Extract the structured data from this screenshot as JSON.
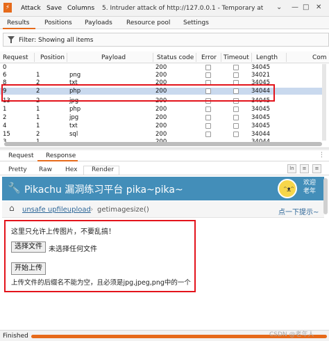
{
  "app": {
    "menu": {
      "attack": "Attack",
      "save": "Save",
      "columns": "Columns"
    },
    "window_title": "5. Intruder attack of http://127.0.0.1 - Temporary attack - ."
  },
  "tabs": [
    "Results",
    "Positions",
    "Payloads",
    "Resource pool",
    "Settings"
  ],
  "filter": {
    "text": "Filter: Showing all items"
  },
  "table": {
    "headers": [
      "Request",
      "Position",
      "Payload",
      "Status code",
      "Error",
      "Timeout",
      "Length",
      "Com"
    ],
    "rows": [
      {
        "request": "0",
        "position": "",
        "payload": "",
        "status": "200",
        "length": "34045"
      },
      {
        "request": "6",
        "position": "1",
        "payload": "png",
        "status": "200",
        "length": "34021"
      },
      {
        "request": "8",
        "position": "2",
        "payload": "txt",
        "status": "200",
        "length": "34045"
      },
      {
        "request": "9",
        "position": "2",
        "payload": "php",
        "status": "200",
        "length": "34044"
      },
      {
        "request": "13",
        "position": "2",
        "payload": "jpg",
        "status": "200",
        "length": "34045"
      },
      {
        "request": "1",
        "position": "1",
        "payload": "php",
        "status": "200",
        "length": "34045"
      },
      {
        "request": "2",
        "position": "1",
        "payload": "jpg",
        "status": "200",
        "length": "34045"
      },
      {
        "request": "4",
        "position": "1",
        "payload": "txt",
        "status": "200",
        "length": "34045"
      },
      {
        "request": "15",
        "position": "2",
        "payload": "sql",
        "status": "200",
        "length": "34044"
      },
      {
        "request": "3",
        "position": "1",
        "payload": "",
        "status": "200",
        "length": "34044"
      }
    ],
    "selected_index": 3
  },
  "request_response_tabs": [
    "Request",
    "Response"
  ],
  "view_tabs": [
    "Pretty",
    "Raw",
    "Hex",
    "Render"
  ],
  "view_tools": [
    "ln",
    "≡",
    "≡"
  ],
  "page": {
    "title": "Pikachu 漏洞练习平台 pika~pika~",
    "welcome_line1": "欢迎",
    "welcome_line2": "老年",
    "breadcrumb_link": "unsafe upfileupload",
    "breadcrumb_current": "getimagesize()",
    "breadcrumb_hint": "点一下提示~",
    "notice": "这里只允许上传图片，不要乱搞！",
    "choose_file": "选择文件",
    "no_file": "未选择任何文件",
    "upload": "开始上传",
    "rule": "上传文件的后缀名不能为空，且必须是jpg,jpeg,png中的一个"
  },
  "status": {
    "text": "Finished",
    "progress": 1.0
  },
  "watermark": "CSDN @老年人",
  "colors": {
    "accent": "#e66a1a",
    "pika_blue": "#438eb9",
    "highlight_red": "#e3131b",
    "selection": "#c9d9ee"
  }
}
